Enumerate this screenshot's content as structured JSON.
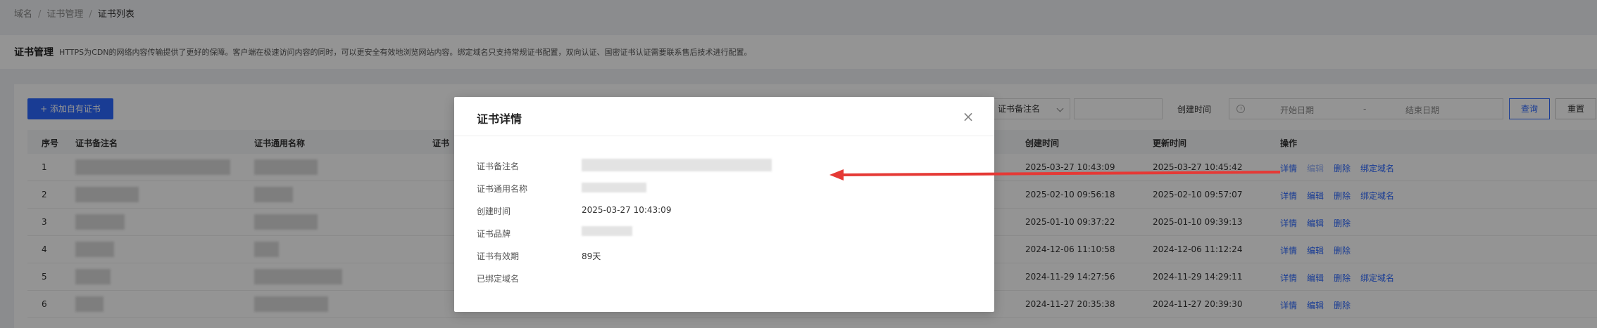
{
  "breadcrumb": {
    "items": [
      "域名",
      "证书管理",
      "证书列表"
    ]
  },
  "header": {
    "title": "证书管理",
    "description": "HTTPS为CDN的网络内容传输提供了更好的保障。客户端在极速访问内容的同时，可以更安全有效地浏览网站内容。绑定域名只支持常规证书配置，双向认证、国密证书认证需要联系售后技术进行配置。"
  },
  "toolbar": {
    "add_label": "+ 添加自有证书",
    "filter_select": "证书备注名",
    "created_label": "创建时间",
    "start_date": "开始日期",
    "date_sep": "-",
    "end_date": "结束日期",
    "query_label": "查询",
    "reset_label": "重置"
  },
  "table": {
    "columns": [
      "序号",
      "证书备注名",
      "证书通用名称",
      "证书",
      "创建时间",
      "更新时间",
      "操作"
    ],
    "rows": [
      {
        "index": "1",
        "created": "2025-03-27 10:43:09",
        "updated": "2025-03-27 10:45:42",
        "actions": [
          "详情",
          "编辑",
          "删除",
          "绑定域名"
        ],
        "edit_disabled": true
      },
      {
        "index": "2",
        "created": "2025-02-10 09:56:18",
        "updated": "2025-02-10 09:57:07",
        "actions": [
          "详情",
          "编辑",
          "删除",
          "绑定域名"
        ],
        "edit_disabled": false
      },
      {
        "index": "3",
        "created": "2025-01-10 09:37:22",
        "updated": "2025-01-10 09:39:13",
        "actions": [
          "详情",
          "编辑",
          "删除"
        ],
        "edit_disabled": false
      },
      {
        "index": "4",
        "created": "2024-12-06 11:10:58",
        "updated": "2024-12-06 11:12:24",
        "actions": [
          "详情",
          "编辑",
          "删除"
        ],
        "edit_disabled": false
      },
      {
        "index": "5",
        "created": "2024-11-29 14:27:56",
        "updated": "2024-11-29 14:29:11",
        "actions": [
          "详情",
          "编辑",
          "删除",
          "绑定域名"
        ],
        "edit_disabled": false
      },
      {
        "index": "6",
        "created": "2024-11-27 20:35:38",
        "updated": "2024-11-27 20:39:30",
        "actions": [
          "详情",
          "编辑",
          "删除"
        ],
        "edit_disabled": false
      }
    ]
  },
  "modal": {
    "title": "证书详情",
    "close_icon": "close-icon",
    "fields": [
      {
        "label": "证书备注名",
        "value": ""
      },
      {
        "label": "证书通用名称",
        "value": ""
      },
      {
        "label": "创建时间",
        "value": "2025-03-27 10:43:09"
      },
      {
        "label": "证书品牌",
        "value": ""
      },
      {
        "label": "证书有效期",
        "value": "89天"
      },
      {
        "label": "已绑定域名",
        "value": ""
      }
    ]
  },
  "colors": {
    "accent": "#2c68ff",
    "arrow": "#e53935",
    "mask": "rgba(0,0,0,0.42)"
  }
}
